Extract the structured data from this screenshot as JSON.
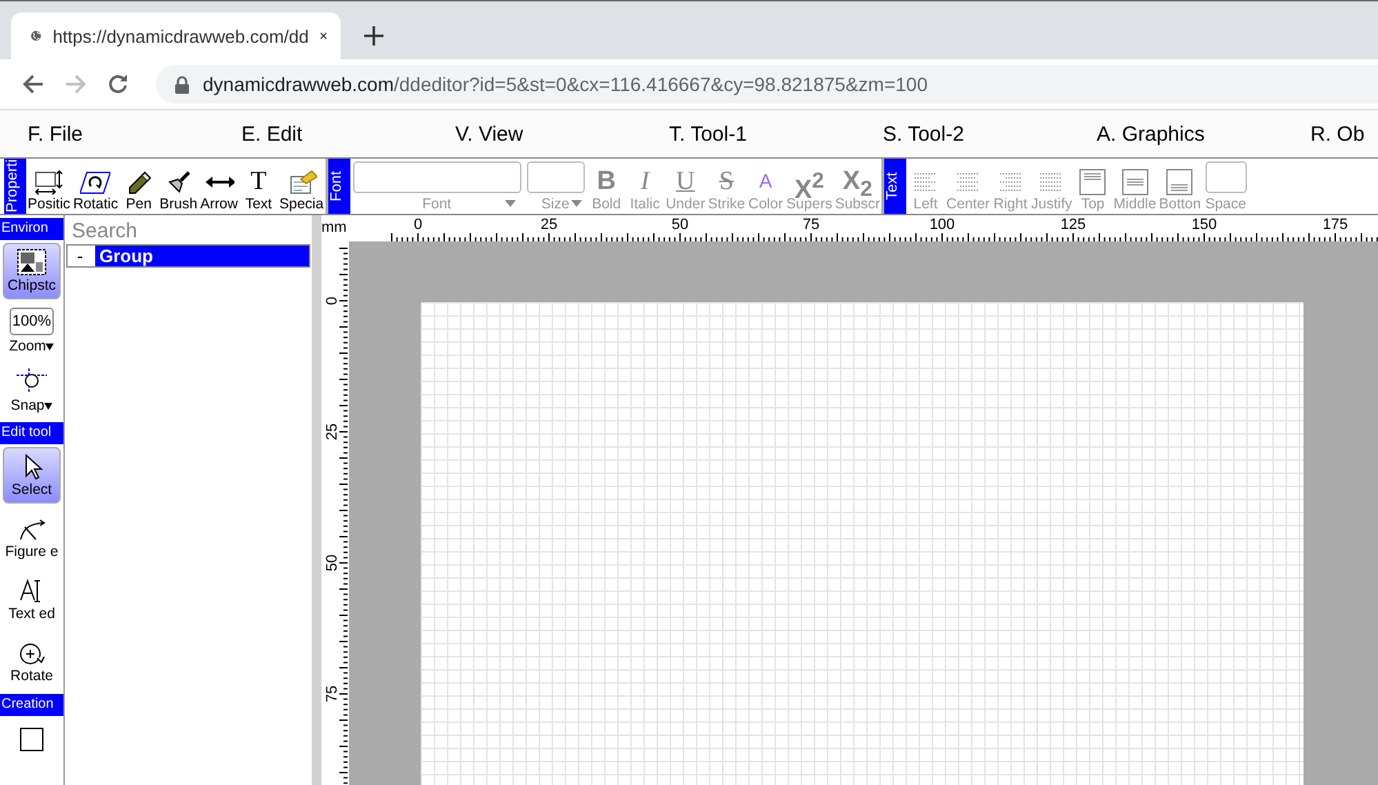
{
  "browser": {
    "tab_title": "https://dynamicdrawweb.com/dd",
    "url_host": "dynamicdrawweb.com",
    "url_path": "/ddeditor?id=5&st=0&cx=116.416667&cy=98.821875&zm=100",
    "forward_disabled": true
  },
  "menu": [
    "F. File",
    "E. Edit",
    "V. View",
    "T. Tool-1",
    "S. Tool-2",
    "A. Graphics",
    "R. Ob"
  ],
  "toolbar": [
    {
      "label": "Properti",
      "items": [
        {
          "kind": "icon",
          "label": "Positic",
          "disabled": false
        },
        {
          "kind": "icon",
          "label": "Rotatic",
          "disabled": false
        },
        {
          "kind": "icon",
          "label": "Pen",
          "disabled": false
        },
        {
          "kind": "icon",
          "label": "Brush",
          "disabled": false
        },
        {
          "kind": "icon",
          "label": "Arrow",
          "disabled": false
        },
        {
          "kind": "glyph",
          "glyph": "T",
          "label": "Text",
          "disabled": false
        },
        {
          "kind": "icon",
          "label": "Specia",
          "disabled": false
        }
      ]
    },
    {
      "label": "Font",
      "items": [
        {
          "kind": "field",
          "label": "Font",
          "disabled": true
        },
        {
          "kind": "field",
          "label": "Size",
          "disabled": true
        },
        {
          "kind": "glyph",
          "glyph": "B",
          "label": "Bold",
          "disabled": true
        },
        {
          "kind": "glyph",
          "glyph": "I",
          "label": "Italic",
          "disabled": true
        },
        {
          "kind": "glyph",
          "glyph": "U",
          "label": "Under",
          "disabled": true
        },
        {
          "kind": "glyph",
          "glyph": "S",
          "label": "Strike",
          "disabled": true
        },
        {
          "kind": "glyph",
          "glyph": "A",
          "label": "Color",
          "disabled": true
        },
        {
          "kind": "glyph",
          "glyph": "X$^{2}$",
          "label": "Supers",
          "disabled": true
        },
        {
          "kind": "glyph",
          "glyph": "X$_{2}$",
          "label": "Subscr",
          "disabled": true
        }
      ]
    },
    {
      "label": "Text",
      "items": [
        {
          "kind": "icon",
          "label": "Left",
          "disabled": true
        },
        {
          "kind": "icon",
          "label": "Center",
          "disabled": true
        },
        {
          "kind": "icon",
          "label": "Right",
          "disabled": true
        },
        {
          "kind": "icon",
          "label": "Justify",
          "disabled": true
        },
        {
          "kind": "icon",
          "label": "Top",
          "disabled": true
        },
        {
          "kind": "icon",
          "label": "Middle",
          "disabled": true
        },
        {
          "kind": "icon",
          "label": "Botton",
          "disabled": true
        },
        {
          "kind": "field",
          "label": "Space",
          "disabled": true
        }
      ]
    }
  ],
  "tool_panel": [
    {
      "title": "Environ",
      "tools": [
        {
          "kind": "tool",
          "label": "Chipstc",
          "selected": true
        },
        {
          "kind": "zoom",
          "value": "100%",
          "label": "Zoom"
        },
        {
          "kind": "dropdown",
          "label": "Snap"
        }
      ]
    },
    {
      "title": "Edit tool",
      "tools": [
        {
          "kind": "tool",
          "label": "Select",
          "selected": true
        },
        {
          "kind": "tool",
          "label": "Figure e",
          "selected": false
        },
        {
          "kind": "tool",
          "label": "Text ed",
          "selected": false
        },
        {
          "kind": "tool",
          "label": "Rotate",
          "selected": false
        }
      ]
    },
    {
      "title": "Creation",
      "tools": [
        {
          "kind": "tool",
          "selected": false
        }
      ]
    }
  ],
  "tree": {
    "search_placeholder": "Search",
    "nodes": [
      {
        "toggle": "-",
        "label": "Group",
        "selected": true
      }
    ]
  },
  "ruler": {
    "unit": "mm",
    "x_labels": [
      "0",
      "25",
      "50",
      "75",
      "100",
      "125",
      "150",
      "175"
    ],
    "y_labels": [
      "0",
      "25",
      "50",
      "75"
    ]
  }
}
